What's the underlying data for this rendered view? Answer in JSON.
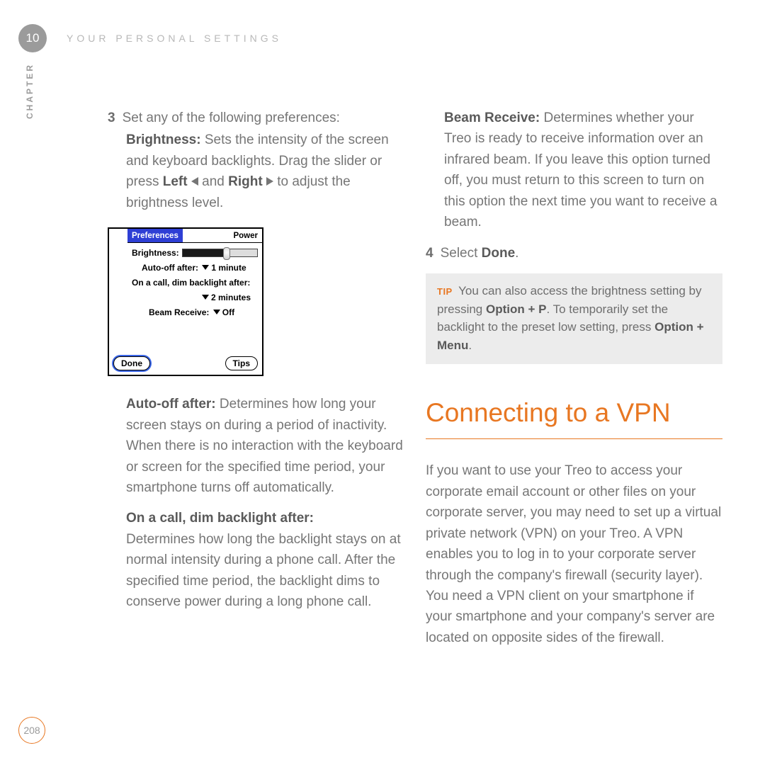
{
  "meta": {
    "chapter_number": "10",
    "chapter_label": "CHAPTER",
    "header_title": "YOUR PERSONAL SETTINGS",
    "page_number": "208"
  },
  "left": {
    "step3_num": "3",
    "step3_text": "Set any of the following preferences:",
    "brightness_label": "Brightness:",
    "brightness_text1": " Sets the intensity of the screen and keyboard backlights. Drag the slider or press ",
    "brightness_left": "Left",
    "brightness_and": " and ",
    "brightness_right": "Right",
    "brightness_text2": " to adjust the brightness level.",
    "device": {
      "tab": "Preferences",
      "title": "Power",
      "brightness": "Brightness:",
      "autooff_label": "Auto-off after:",
      "autooff_val": "1 minute",
      "oncall": "On a call, dim backlight after:",
      "oncall_val": "2 minutes",
      "beam_label": "Beam Receive:",
      "beam_val": "Off",
      "done": "Done",
      "tips": "Tips"
    },
    "autooff_label": "Auto-off after:",
    "autooff_text": " Determines how long your screen stays on during a period of inactivity. When there is no interaction with the keyboard or screen for the specified time period, your smartphone turns off automatically.",
    "oncall_label": "On a call, dim backlight after:",
    "oncall_text": "Determines how long the backlight stays on at normal intensity during a phone call. After the specified time period, the backlight dims to conserve power during a long phone call."
  },
  "right": {
    "beam_label": "Beam Receive:",
    "beam_text": " Determines whether your Treo is ready to receive information over an infrared beam. If you leave this option turned off, you must return to this screen to turn on this option the next time you want to receive a beam.",
    "step4_num": "4",
    "step4_text": "Select ",
    "step4_done": "Done",
    "step4_period": ".",
    "tip": {
      "label": "TIP",
      "text1": " You can also access the brightness setting by pressing ",
      "combo1": "Option + P",
      "text2": ". To temporarily set the backlight to the preset low setting, press ",
      "combo2": "Option + Menu",
      "period": "."
    },
    "section_heading": "Connecting to a VPN",
    "vpn_text": "If you want to use your Treo to access your corporate email account or other files on your corporate server, you may need to set up a virtual private network (VPN) on your Treo. A VPN enables you to log in to your corporate server through the company's firewall (security layer). You need a VPN client on your smartphone if your smartphone and your company's server are located on opposite sides of the firewall."
  }
}
